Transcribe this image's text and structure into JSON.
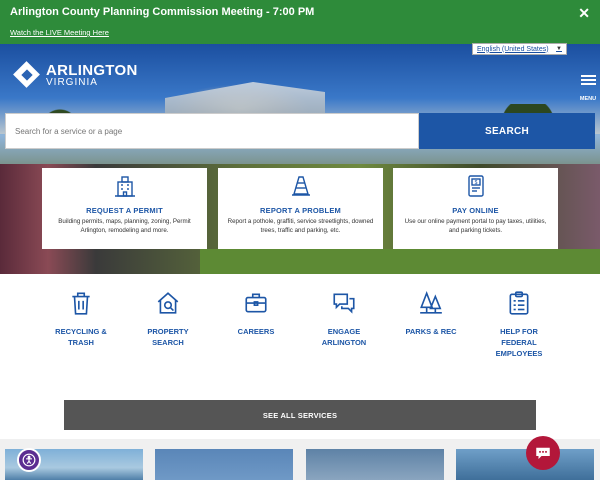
{
  "alert": {
    "title": "Arlington County Planning Commission Meeting - 7:00 PM",
    "link": "Watch the LIVE Meeting Here",
    "close": "✕"
  },
  "header": {
    "logo_name": "ARLINGTON",
    "logo_sub": "VIRGINIA",
    "language": "English (United States)",
    "language_arrow": "▼",
    "menu_label": "MENU"
  },
  "search": {
    "placeholder": "Search for a service or a page",
    "button": "SEARCH"
  },
  "cards": [
    {
      "title": "REQUEST A PERMIT",
      "desc": "Building permits, maps, planning, zoning, Permit Arlington, remodeling and more.",
      "icon": "building-icon"
    },
    {
      "title": "REPORT A PROBLEM",
      "desc": "Report a pothole, graffiti, service streetlights, downed trees, traffic and parking, etc.",
      "icon": "traffic-cone-icon"
    },
    {
      "title": "PAY ONLINE",
      "desc": "Use our online payment portal to pay taxes, utilities, and parking tickets.",
      "icon": "payment-kiosk-icon"
    }
  ],
  "services": [
    {
      "label": "RECYCLING & TRASH",
      "icon": "trash-can-icon"
    },
    {
      "label": "PROPERTY SEARCH",
      "icon": "house-search-icon"
    },
    {
      "label": "CAREERS",
      "icon": "briefcase-icon"
    },
    {
      "label": "ENGAGE ARLINGTON",
      "icon": "chat-bubbles-icon"
    },
    {
      "label": "PARKS & REC",
      "icon": "trees-icon"
    },
    {
      "label": "HELP FOR FEDERAL EMPLOYEES",
      "icon": "clipboard-icon"
    }
  ],
  "see_all": "SEE ALL SERVICES",
  "colors": {
    "alert_green": "#2e8b3a",
    "brand_blue": "#1d56a6",
    "see_all_gray": "#555555",
    "chat_red": "#b3173a",
    "accessibility_purple": "#5b2d91"
  }
}
